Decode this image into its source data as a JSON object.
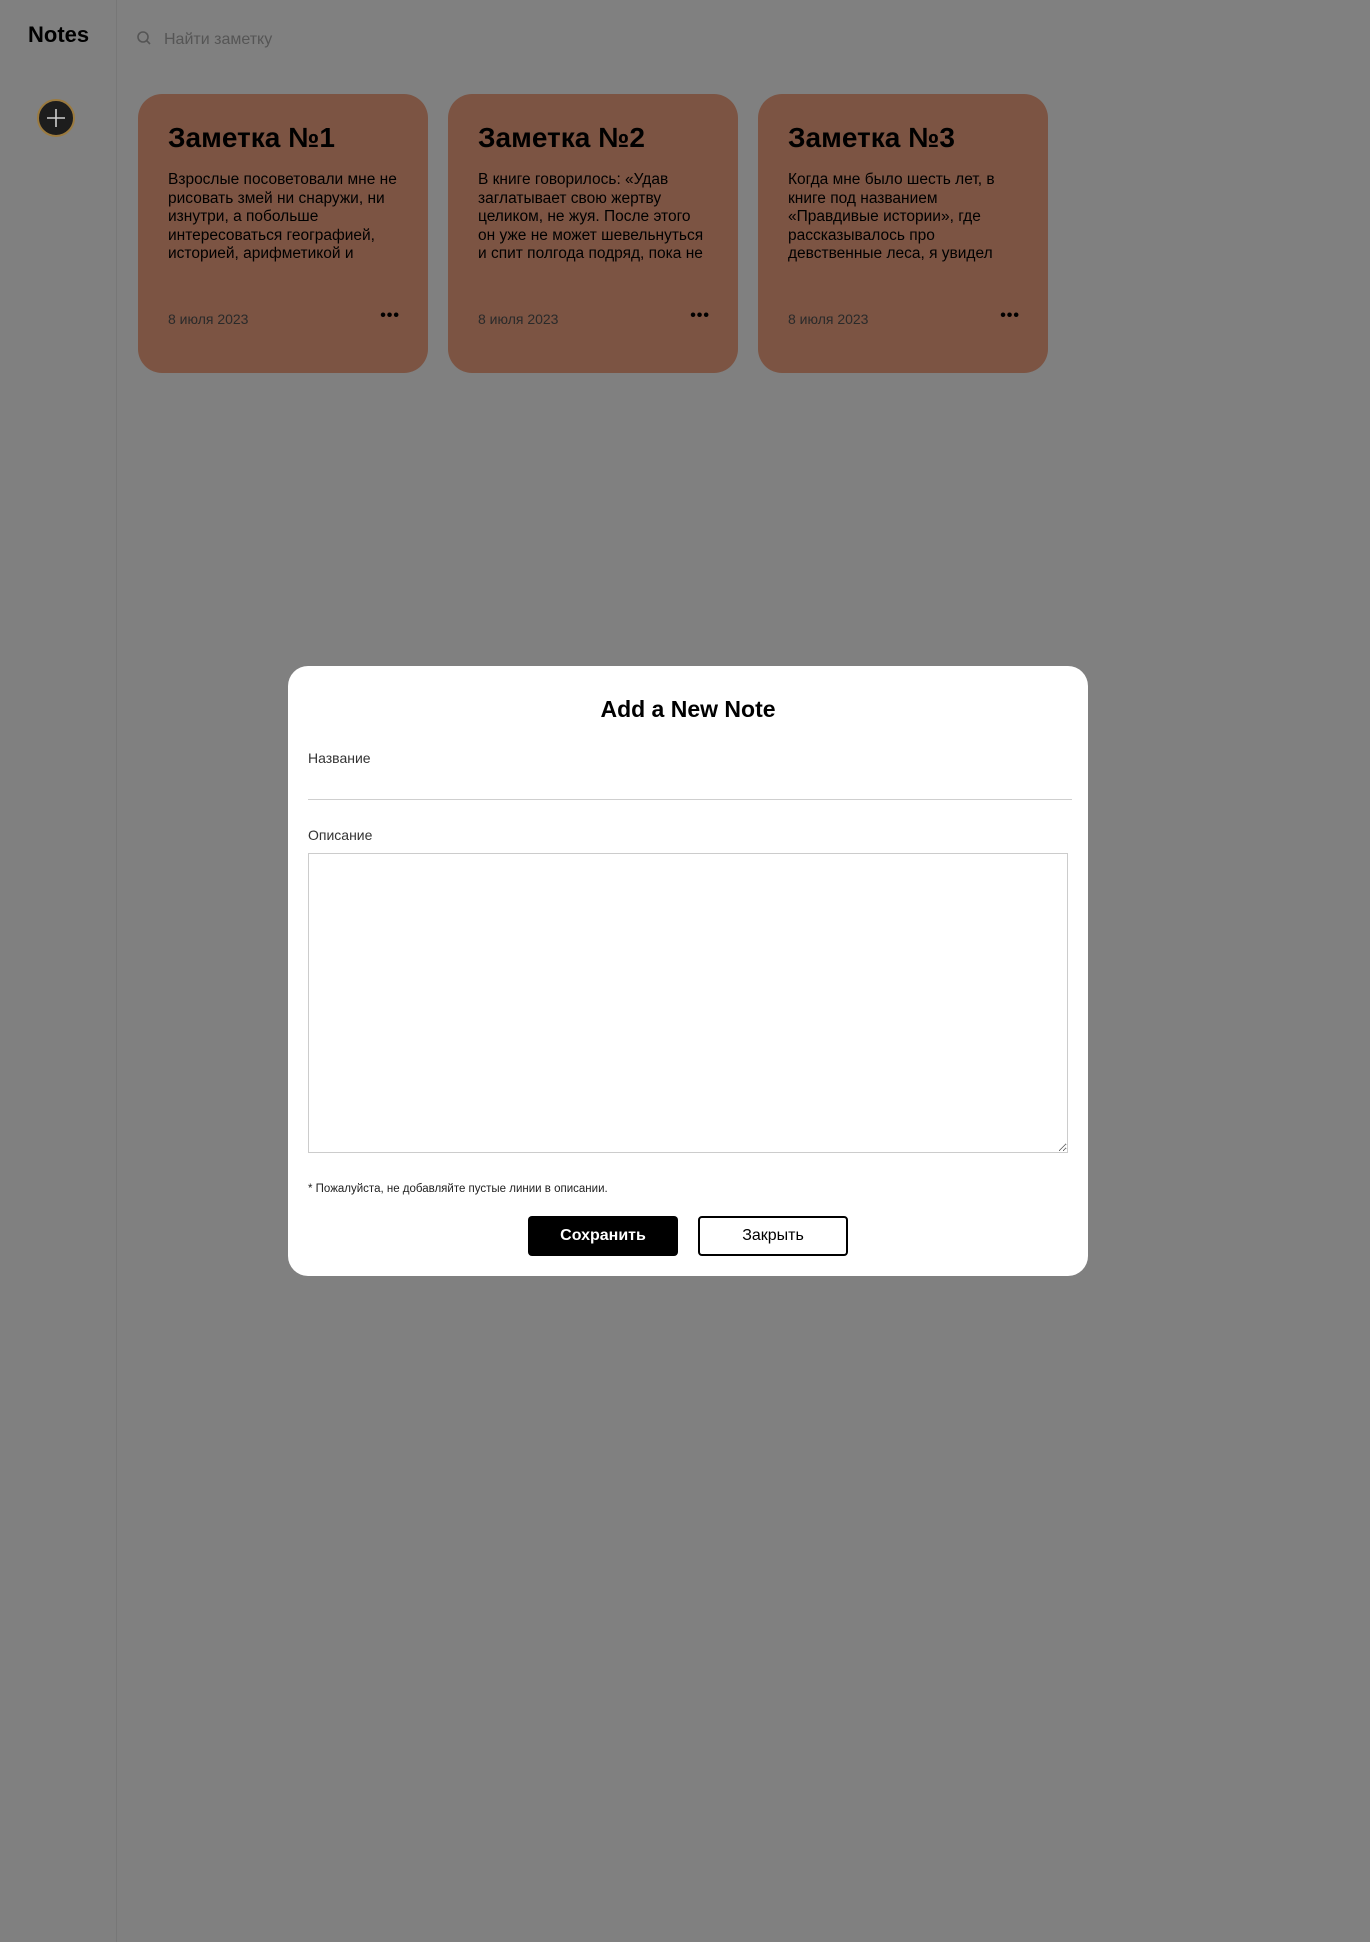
{
  "app": {
    "title": "Notes"
  },
  "search": {
    "placeholder": "Найти заметку"
  },
  "notes": [
    {
      "title": "Заметка №1",
      "text": "Взрослые посоветовали мне не рисовать змей ни снаружи, ни изнутри, а побольше интересоваться географией, историей, арифметикой и",
      "date": "8 июля 2023",
      "menu": "•••"
    },
    {
      "title": "Заметка №2",
      "text": "В книге говорилось: «Удав заглатывает свою жертву целиком, не жуя. После этого он уже не может шевельнуться и спит полгода подряд, пока не переварит",
      "date": "8 июля 2023",
      "menu": "•••"
    },
    {
      "title": "Заметка №3",
      "text": "Когда мне было шесть лет, в книге под названием «Правдивые истории», где рассказывалось про девственные леса, я увидел однажды удивительную",
      "date": "8 июля 2023",
      "menu": "•••"
    }
  ],
  "modal": {
    "title": "Add a New Note",
    "name_label": "Название",
    "name_value": "",
    "description_label": "Описание",
    "description_value": "",
    "hint": "* Пожалуйста, не добавляйте пустые линии в описании.",
    "save_label": "Сохранить",
    "close_label": "Закрыть"
  },
  "colors": {
    "overlay": "#808080",
    "card": "#7c5443",
    "add_button": "#1d1d1d",
    "add_button_ring": "#9b7a3e"
  }
}
